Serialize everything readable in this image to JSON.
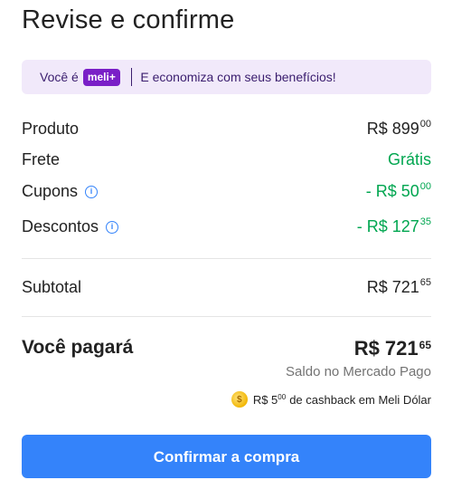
{
  "title": "Revise e confirme",
  "banner": {
    "prefix": "Você é",
    "badge": "meli+",
    "message": "E economiza com seus benefícios!"
  },
  "summary": {
    "produto": {
      "label": "Produto",
      "amount": "R$ 899",
      "cents": "00"
    },
    "frete": {
      "label": "Frete",
      "amount": "Grátis"
    },
    "cupons": {
      "label": "Cupons",
      "amount": "- R$ 50",
      "cents": "00"
    },
    "descontos": {
      "label": "Descontos",
      "amount": "- R$ 127",
      "cents": "35"
    },
    "subtotal": {
      "label": "Subtotal",
      "amount": "R$ 721",
      "cents": "65"
    }
  },
  "total": {
    "label": "Você pagará",
    "amount": "R$ 721",
    "cents": "65",
    "method": "Saldo no Mercado Pago"
  },
  "cashback": {
    "amount": "R$ 5",
    "cents": "00",
    "text": "de cashback em Meli Dólar"
  },
  "cta": {
    "label": "Confirmar a compra"
  },
  "colors": {
    "accent": "#3483fa",
    "green": "#00a650",
    "meli_purple": "#7a1fc7",
    "banner_bg": "#f1e9fa"
  }
}
